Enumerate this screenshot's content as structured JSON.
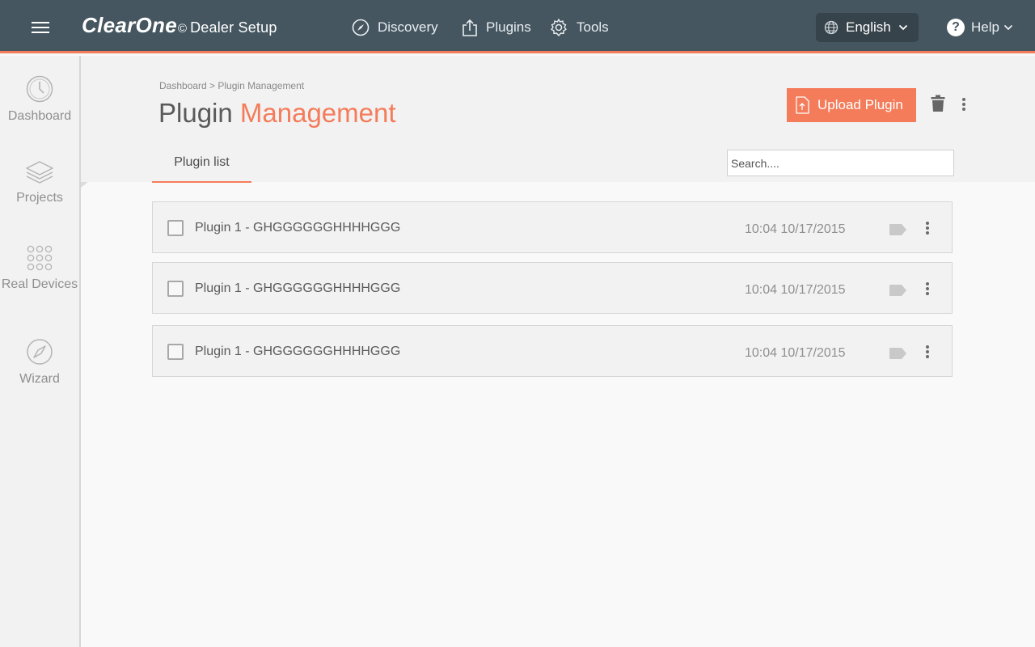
{
  "topbar": {
    "brand_logo": "ClearOne",
    "brand_copyright": "©",
    "brand_subtitle": "Dealer Setup",
    "nav": [
      {
        "label": "Discovery",
        "icon": "compass-icon"
      },
      {
        "label": "Plugins",
        "icon": "upload-icon"
      },
      {
        "label": "Tools",
        "icon": "gear-icon"
      }
    ],
    "language": "English",
    "help": "Help"
  },
  "sidebar": {
    "items": [
      {
        "label": "Dashboard",
        "icon": "clock-icon"
      },
      {
        "label": "Projects",
        "icon": "layers-icon"
      },
      {
        "label": "Real Devices",
        "icon": "grid-dots-icon"
      },
      {
        "label": "Wizard",
        "icon": "compass-icon"
      }
    ]
  },
  "header": {
    "breadcrumb": "Dashboard > Plugin Management",
    "title_main": "Plugin ",
    "title_accent": "Management",
    "upload_label": "Upload Plugin"
  },
  "tabs": [
    {
      "label": "Plugin list",
      "active": true
    }
  ],
  "search": {
    "placeholder": "Search....",
    "value": ""
  },
  "plugins": [
    {
      "name": "Plugin 1 - GHGGGGGGHHHHGGG",
      "timestamp": "10:04 10/17/2015"
    },
    {
      "name": "Plugin 1 - GHGGGGGGHHHHGGG",
      "timestamp": "10:04 10/17/2015"
    },
    {
      "name": "Plugin 1 - GHGGGGGGHHHHGGG",
      "timestamp": "10:04 10/17/2015"
    }
  ],
  "colors": {
    "topbar": "#455660",
    "accent": "#f47c5a",
    "language_bg": "#37434b",
    "sidebar_bg": "#f2f2f2"
  }
}
